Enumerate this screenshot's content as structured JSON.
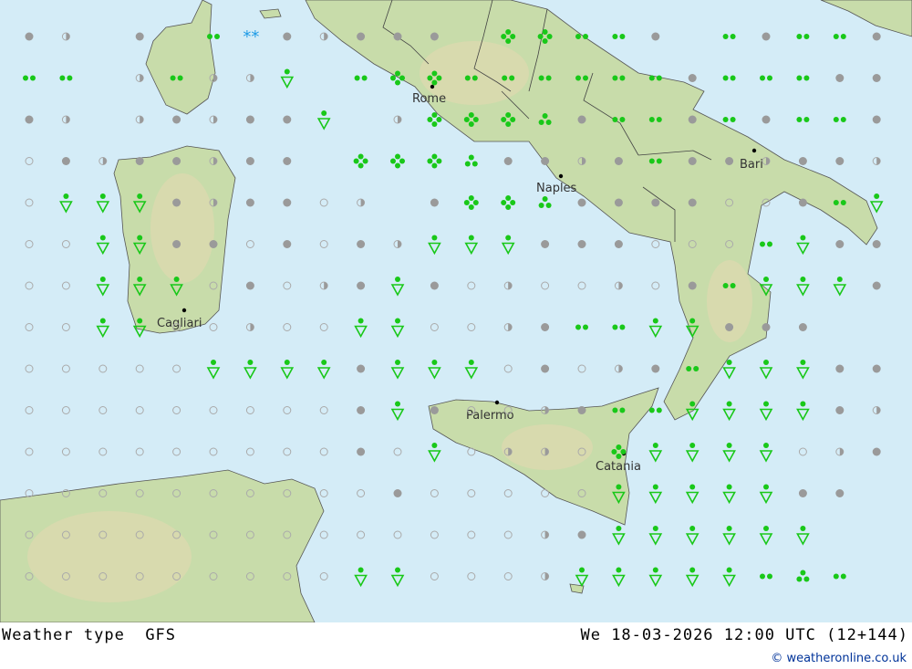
{
  "footer": {
    "left_label": "Weather type",
    "model": "GFS",
    "datetime": "We 18-03-2026 12:00 UTC (12+144)",
    "copyright": "© weatheronline.co.uk"
  },
  "cities": [
    {
      "name": "Rome"
    },
    {
      "name": "Naples"
    },
    {
      "name": "Bari"
    },
    {
      "name": "Cagliari"
    },
    {
      "name": "Palermo"
    },
    {
      "name": "Catania"
    }
  ],
  "colors": {
    "sea": "#d4ecf7",
    "land": "#c4d8a4",
    "rain_symbol": "#19c819",
    "snow_symbol": "#1e9be6",
    "cloud_symbol": "#9a9a9a"
  },
  "symbol_legend": {
    "o": "clear",
    "h": "partly-cloudy",
    "c": "cloudy",
    "r": "rain",
    "d": "drizzle",
    "s": "showers",
    "t": "rain-showers",
    "x": "heavy-rain",
    "w": "snow"
  },
  "weather_grid": [
    "ch.c.rwchccc.xxrrc.rcrrcccccohh",
    "rr.hrhhs.rxxrrrrrrcrrrcccccoco",
    "ch.hchccs.hxxxtcrrcrcrrccccocco",
    "ochcchcc.xxxtcchcrcchcchcoco",
    "ossschccoh.cxxtccccoocrsccch",
    "oossccocochssscccooorscchcc",
    "oosssocohcscohoohocrsssccccc",
    "oossoohoossoohcrrssccc",
    "ooooosssscsssocohcrssscc",
    "ooooooooocscoohcrrssssch",
    "ooooooooocosohhoxssssohc",
    "oooooooooocooooossssscc",
    "oooooooooooooohcssssss",
    "ooooooooossooohsssssrtr"
  ]
}
